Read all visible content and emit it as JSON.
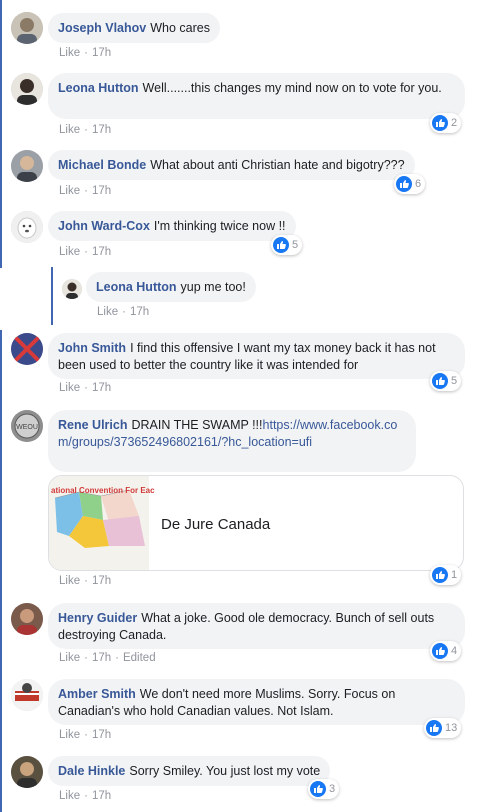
{
  "comments": [
    {
      "author": "Joseph Vlahov",
      "text": "Who cares",
      "like": "Like",
      "time": "17h",
      "reactions": ""
    },
    {
      "author": "Leona Hutton",
      "text": "Well.......this changes my mind now on to vote for you.",
      "like": "Like",
      "time": "17h",
      "reactions": "2"
    },
    {
      "author": "Michael Bonde",
      "text": "What about anti Christian hate and bigotry???",
      "like": "Like",
      "time": "17h",
      "reactions": "6"
    },
    {
      "author": "John Ward-Cox",
      "text": "I'm thinking twice now !!",
      "like": "Like",
      "time": "17h",
      "reactions": "5"
    },
    {
      "author": "Leona Hutton",
      "text": "yup me too!",
      "like": "Like",
      "time": "17h",
      "reactions": ""
    },
    {
      "author": "John Smith",
      "text": "I find this offensive I want my tax money back it has not been used to better the country like it was intended for",
      "like": "Like",
      "time": "17h",
      "reactions": "5"
    },
    {
      "author": "Rene Ulrich",
      "text": "DRAIN THE SWAMP !!!",
      "link": "https://www.facebook.com/groups/373652496802161/?hc_location=ufi",
      "like": "Like",
      "time": "17h",
      "reactions": "1"
    },
    {
      "author": "Henry Guider",
      "text": "What a joke. Good ole democracy. Bunch of sell outs destroying Canada.",
      "like": "Like",
      "time": "17h",
      "edited": "Edited",
      "reactions": "4"
    },
    {
      "author": "Amber Smith",
      "text": "We don't need more Muslims. Sorry. Focus on Canadian's who hold Canadian values. Not Islam.",
      "like": "Like",
      "time": "17h",
      "reactions": "13"
    },
    {
      "author": "Dale Hinkle",
      "text": "Sorry Smiley. You just lost my vote",
      "like": "Like",
      "time": "17h",
      "reactions": "3"
    }
  ],
  "link_preview": {
    "title": "De Jure Canada",
    "image_caption": "ational Convention For Eac"
  },
  "colors": {
    "author": "#385898",
    "bubble": "#f2f3f5",
    "like_blue": "#1877f2",
    "meta": "#90949c"
  }
}
